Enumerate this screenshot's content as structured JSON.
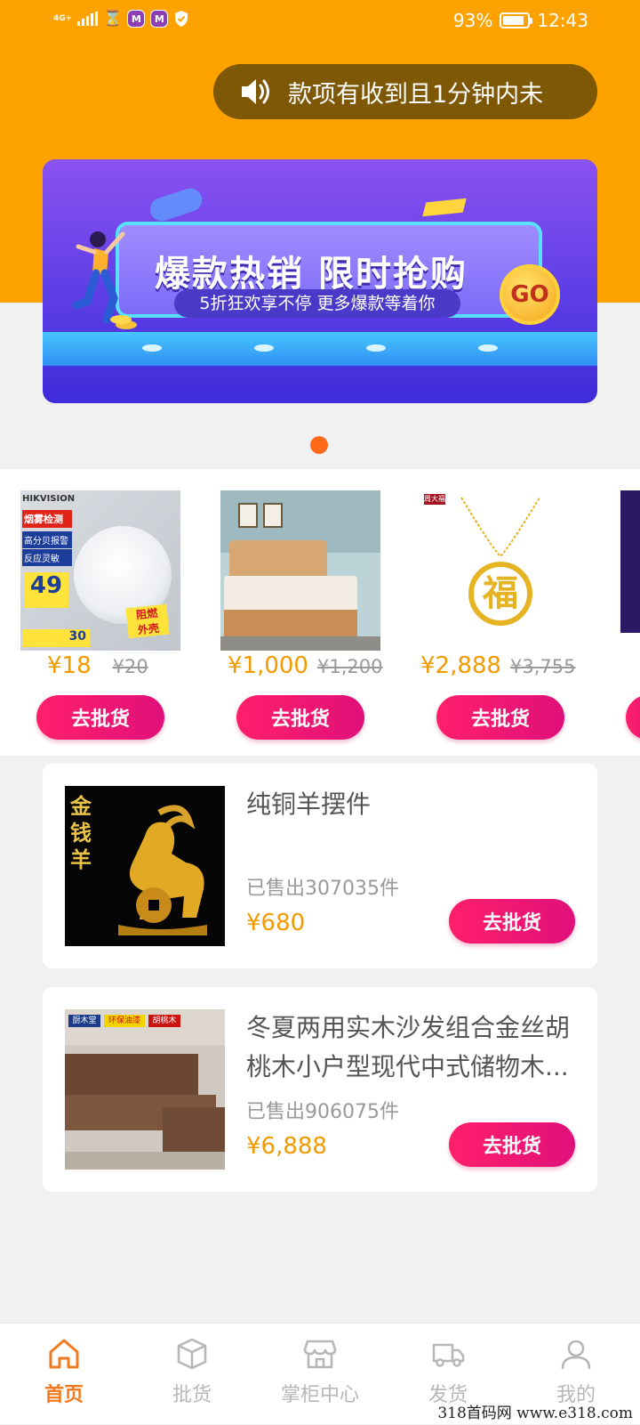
{
  "status_bar": {
    "network_label": "4G+",
    "battery": "93%",
    "time": "12:43",
    "app_badge": "M"
  },
  "notice": {
    "text": "款项有收到且1分钟内未"
  },
  "banner": {
    "title": "爆款热销 限时抢购",
    "subtitle": "5折狂欢享不停 更多爆款等着你",
    "go_label": "GO"
  },
  "strip_products": [
    {
      "price": "¥18",
      "original_price": "¥20",
      "button": "去批货",
      "image_brand": "HIKVISION",
      "image_tags": [
        "烟雾检测",
        "高分贝报警",
        "反应灵敏",
        "49",
        "阻燃",
        "外壳",
        "30"
      ]
    },
    {
      "price": "¥1,000",
      "original_price": "¥1,200",
      "button": "去批货"
    },
    {
      "price": "¥2,888",
      "original_price": "¥3,755",
      "button": "去批货",
      "image_char": "福",
      "image_brand": "周大福"
    }
  ],
  "list_products": [
    {
      "title": "纯铜羊摆件",
      "sold": "已售出307035件",
      "price": "¥680",
      "button": "去批货",
      "image_text": "金钱羊"
    },
    {
      "title": "冬夏两用实木沙发组合金丝胡桃木小户型现代中式储物木...",
      "sold": "已售出906075件",
      "price": "¥6,888",
      "button": "去批货",
      "image_tags": [
        "厨木堂",
        "环保油漆",
        "胡桃木"
      ]
    }
  ],
  "bottom_nav": [
    {
      "label": "首页",
      "icon": "home-icon",
      "active": true
    },
    {
      "label": "批货",
      "icon": "box-icon",
      "active": false
    },
    {
      "label": "掌柜中心",
      "icon": "store-icon",
      "active": false
    },
    {
      "label": "发货",
      "icon": "truck-icon",
      "active": false
    },
    {
      "label": "我的",
      "icon": "user-icon",
      "active": false
    }
  ],
  "watermark": "318首码网 www.e318.com",
  "colors": {
    "header": "#fea200",
    "accent_price": "#f29a00",
    "button": "#ff1f6b",
    "nav_active": "#ef7a1f",
    "page_dot": "#ff6a1a"
  }
}
